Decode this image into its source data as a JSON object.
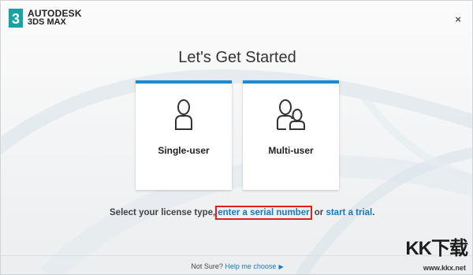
{
  "brand": {
    "line1": "AUTODESK",
    "line2": "3DS MAX",
    "mark": "3"
  },
  "window": {
    "close_glyph": "×"
  },
  "title": "Let's Get Started",
  "cards": [
    {
      "label": "Single-user",
      "icon": "single-user-icon"
    },
    {
      "label": "Multi-user",
      "icon": "multi-user-icon"
    }
  ],
  "prompt": {
    "prefix": "Select your license type,",
    "serial_link": "enter a serial number",
    "middle": " or ",
    "trial_link": "start a trial",
    "suffix": "."
  },
  "footer": {
    "prefix": "Not Sure? ",
    "link": "Help me choose",
    "arrow": "▶"
  },
  "watermark": {
    "logo": "KK下载",
    "url": "www.kkx.net"
  },
  "colors": {
    "accent": "#1b8ad1",
    "link": "#1b78b8",
    "highlight": "#e0201f"
  }
}
